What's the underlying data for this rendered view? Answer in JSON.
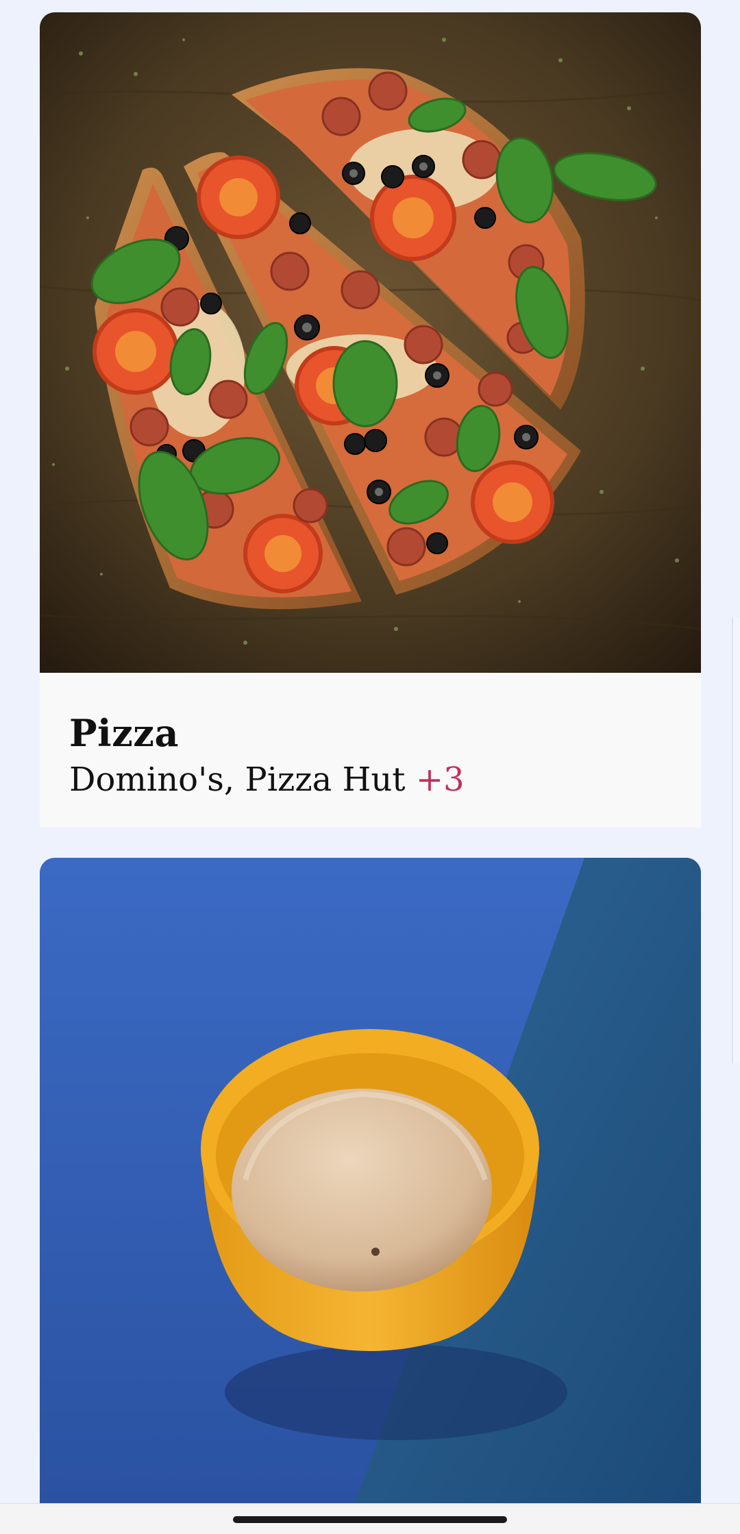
{
  "feed": {
    "cards": [
      {
        "title": "Pizza",
        "subtitle": "Domino's, Pizza Hut",
        "more": "+3",
        "image": "pizza-photo"
      },
      {
        "image": "ice-cream-photo"
      }
    ]
  },
  "colors": {
    "page_background": "#eef2fd",
    "card_background": "#f9f9f9",
    "accent": "#c2315a"
  }
}
